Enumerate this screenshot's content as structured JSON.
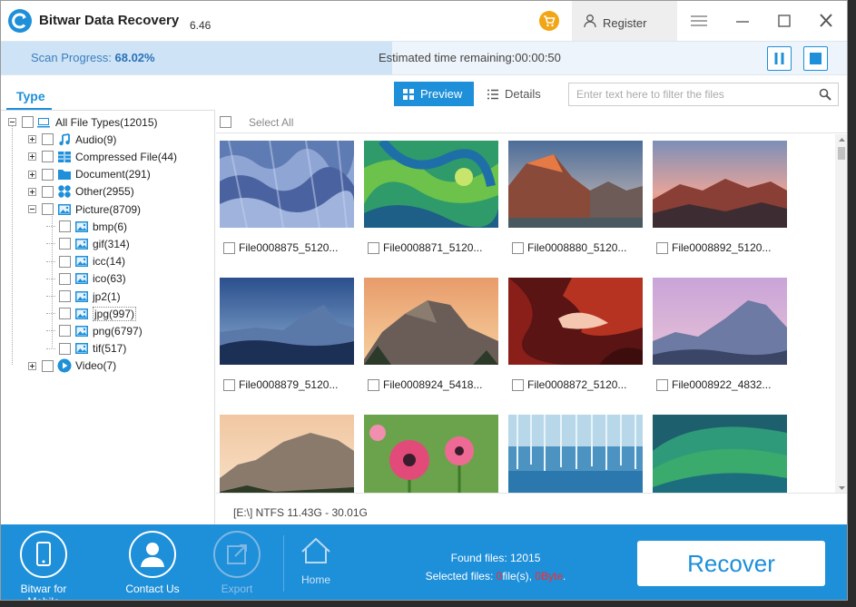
{
  "app": {
    "name": "Bitwar Data Recovery",
    "version": "6.46",
    "register_label": "Register"
  },
  "scan": {
    "label": "Scan Progress:",
    "value": "68.02%",
    "progress": 0.6802,
    "time_label": "Estimated time remaining:00:00:50"
  },
  "sidebar": {
    "tab_label": "Type",
    "tree": [
      {
        "label": "All File Types(12015)",
        "level": 0,
        "icon": "computer-icon"
      },
      {
        "label": "Audio(9)",
        "level": 1,
        "icon": "music-note-icon"
      },
      {
        "label": "Compressed File(44)",
        "level": 1,
        "icon": "archive-icon"
      },
      {
        "label": "Document(291)",
        "level": 1,
        "icon": "folder-icon"
      },
      {
        "label": "Other(2955)",
        "level": 1,
        "icon": "grid-icon"
      },
      {
        "label": "Picture(8709)",
        "level": 1,
        "icon": "image-icon"
      },
      {
        "label": "bmp(6)",
        "level": 2,
        "icon": "image-icon"
      },
      {
        "label": "gif(314)",
        "level": 2,
        "icon": "image-icon"
      },
      {
        "label": "icc(14)",
        "level": 2,
        "icon": "image-icon"
      },
      {
        "label": "ico(63)",
        "level": 2,
        "icon": "image-icon"
      },
      {
        "label": "jp2(1)",
        "level": 2,
        "icon": "image-icon"
      },
      {
        "label": "jpg(997)",
        "level": 2,
        "icon": "image-icon",
        "selected": true
      },
      {
        "label": "png(6797)",
        "level": 2,
        "icon": "image-icon"
      },
      {
        "label": "tif(517)",
        "level": 2,
        "icon": "image-icon"
      },
      {
        "label": "Video(7)",
        "level": 1,
        "icon": "play-icon"
      }
    ]
  },
  "toolbar": {
    "preview_label": "Preview",
    "details_label": "Details",
    "filter_placeholder": "Enter text here to filter the files"
  },
  "content": {
    "select_all_label": "Select All",
    "files": [
      "File0008875_5120...",
      "File0008871_5120...",
      "File0008880_5120...",
      "File0008892_5120...",
      "File0008879_5120...",
      "File0008924_5418...",
      "File0008872_5120...",
      "File0008922_4832...",
      "",
      "",
      "",
      ""
    ],
    "status": "[E:\\] NTFS 11.43G - 30.01G"
  },
  "bottom": {
    "mobile_label": "Bitwar for Mobile",
    "contact_label": "Contact Us",
    "export_label": "Export",
    "home_label": "Home",
    "found_label": "Found files: 12015",
    "selected_prefix": "Selected files: ",
    "selected_count": "0",
    "selected_mid": "file(s), ",
    "selected_size": "0Byte",
    "selected_suffix": ".",
    "recover_label": "Recover"
  },
  "colors": {
    "accent": "#1e8fd9",
    "cart": "#f2a515",
    "alert": "#ff2a2a"
  }
}
